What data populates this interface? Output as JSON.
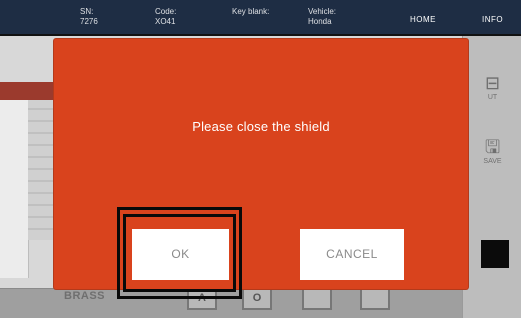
{
  "header": {
    "fields": [
      {
        "label": "SN:",
        "value": "7276"
      },
      {
        "label": "Code:",
        "value": "XO41"
      },
      {
        "label": "Key blank:",
        "value": ""
      },
      {
        "label": "Vehicle:",
        "value": "Honda"
      }
    ],
    "nav": {
      "home_label": "HOME",
      "info_label": "INFO"
    }
  },
  "side_panel": {
    "items": [
      {
        "icon": "cut-icon",
        "label": "UT"
      },
      {
        "icon": "save-icon",
        "label": "SAVE"
      }
    ]
  },
  "bottom": {
    "material_label": "BRASS",
    "key_labels": [
      "A",
      "O"
    ]
  },
  "dialog": {
    "message": "Please close the shield",
    "ok_label": "OK",
    "cancel_label": "CANCEL",
    "background_color": "#d9431d"
  }
}
